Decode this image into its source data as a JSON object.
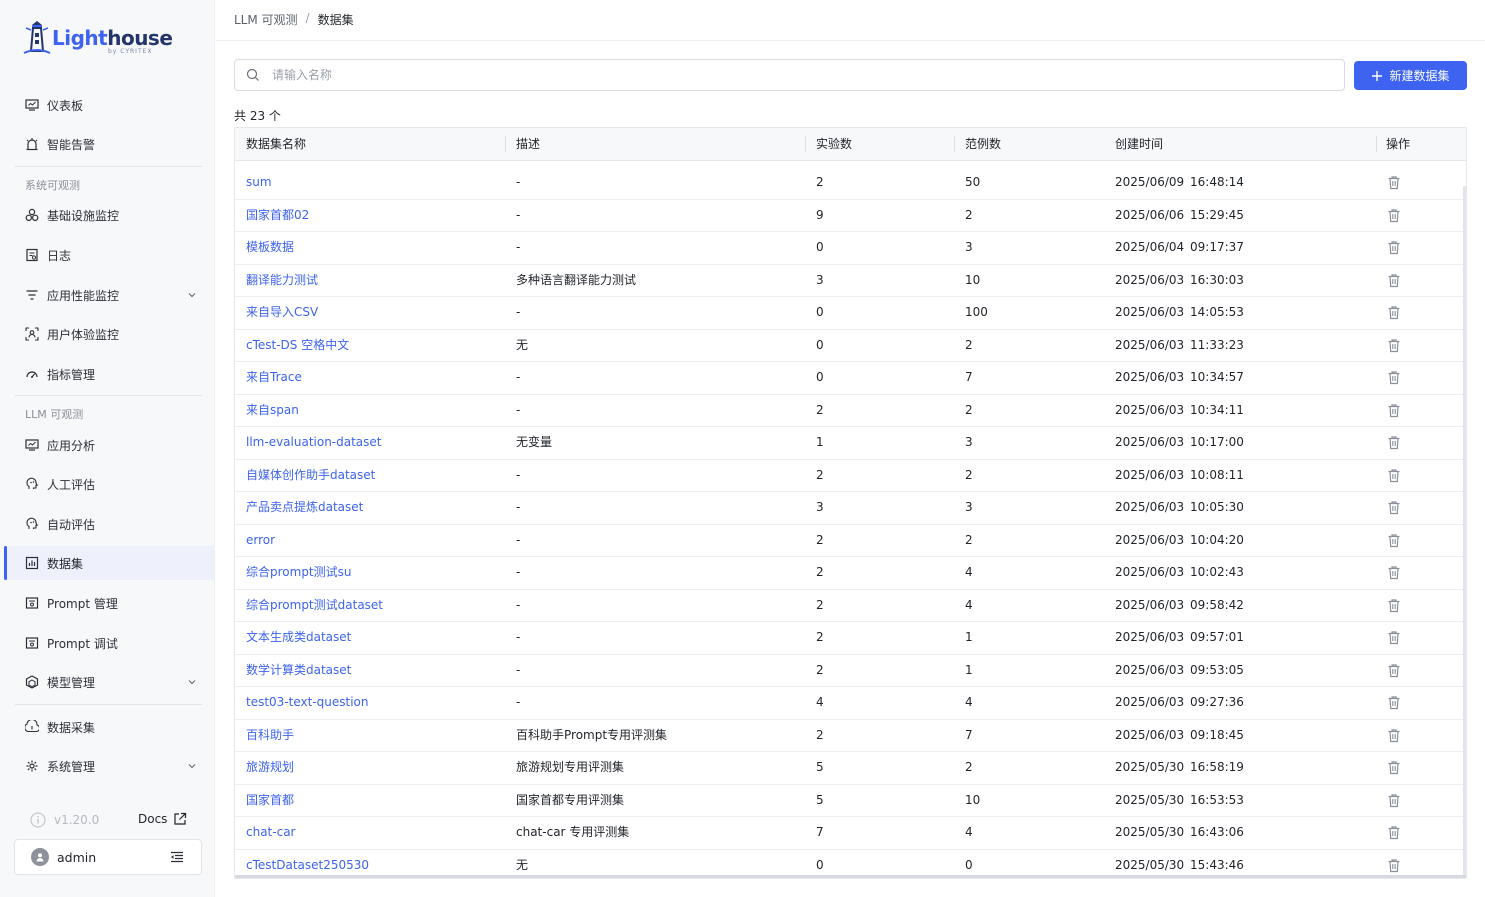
{
  "brand": {
    "name_a": "Light",
    "name_b": "house",
    "sub": "by CYRITEX"
  },
  "nav": {
    "dashboard": "仪表板",
    "alerts": "智能告警",
    "section_system": "系统可观测",
    "infra": "基础设施监控",
    "logs": "日志",
    "apm": "应用性能监控",
    "rum": "用户体验监控",
    "metrics": "指标管理",
    "section_llm": "LLM 可观测",
    "app_analysis": "应用分析",
    "human_eval": "人工评估",
    "auto_eval": "自动评估",
    "datasets": "数据集",
    "prompt_mgmt": "Prompt 管理",
    "prompt_debug": "Prompt 调试",
    "model_mgmt": "模型管理",
    "data_collect": "数据采集",
    "sys_mgmt": "系统管理"
  },
  "footer": {
    "version": "v1.20.0",
    "docs": "Docs",
    "user": "admin"
  },
  "breadcrumb": {
    "parent": "LLM 可观测",
    "sep": "/",
    "current": "数据集"
  },
  "search": {
    "placeholder": "请输入名称",
    "value": ""
  },
  "new_button": "新建数据集",
  "total": "共 23 个",
  "columns": {
    "name": "数据集名称",
    "desc": "描述",
    "experiments": "实验数",
    "examples": "范例数",
    "created": "创建时间",
    "actions": "操作"
  },
  "rows": [
    {
      "name": "sum",
      "desc": "-",
      "exp": "2",
      "ex": "50",
      "date": "2025/06/09",
      "time": "16:48:14"
    },
    {
      "name": "国家首都02",
      "desc": "-",
      "exp": "9",
      "ex": "2",
      "date": "2025/06/06",
      "time": "15:29:45"
    },
    {
      "name": "模板数据",
      "desc": "-",
      "exp": "0",
      "ex": "3",
      "date": "2025/06/04",
      "time": "09:17:37"
    },
    {
      "name": "翻译能力测试",
      "desc": "多种语言翻译能力测试",
      "exp": "3",
      "ex": "10",
      "date": "2025/06/03",
      "time": "16:30:03"
    },
    {
      "name": "来自导入CSV",
      "desc": "-",
      "exp": "0",
      "ex": "100",
      "date": "2025/06/03",
      "time": "14:05:53"
    },
    {
      "name": "cTest-DS 空格中文",
      "desc": "无",
      "exp": "0",
      "ex": "2",
      "date": "2025/06/03",
      "time": "11:33:23"
    },
    {
      "name": "来自Trace",
      "desc": "-",
      "exp": "0",
      "ex": "7",
      "date": "2025/06/03",
      "time": "10:34:57"
    },
    {
      "name": "来自span",
      "desc": "-",
      "exp": "2",
      "ex": "2",
      "date": "2025/06/03",
      "time": "10:34:11"
    },
    {
      "name": "llm-evaluation-dataset",
      "desc": "无变量",
      "exp": "1",
      "ex": "3",
      "date": "2025/06/03",
      "time": "10:17:00"
    },
    {
      "name": "自媒体创作助手dataset",
      "desc": "-",
      "exp": "2",
      "ex": "2",
      "date": "2025/06/03",
      "time": "10:08:11"
    },
    {
      "name": "产品卖点提炼dataset",
      "desc": "-",
      "exp": "3",
      "ex": "3",
      "date": "2025/06/03",
      "time": "10:05:30"
    },
    {
      "name": "error",
      "desc": "-",
      "exp": "2",
      "ex": "2",
      "date": "2025/06/03",
      "time": "10:04:20"
    },
    {
      "name": "综合prompt测试su",
      "desc": "-",
      "exp": "2",
      "ex": "4",
      "date": "2025/06/03",
      "time": "10:02:43"
    },
    {
      "name": "综合prompt测试dataset",
      "desc": "-",
      "exp": "2",
      "ex": "4",
      "date": "2025/06/03",
      "time": "09:58:42"
    },
    {
      "name": "文本生成类dataset",
      "desc": "-",
      "exp": "2",
      "ex": "1",
      "date": "2025/06/03",
      "time": "09:57:01"
    },
    {
      "name": "数学计算类dataset",
      "desc": "-",
      "exp": "2",
      "ex": "1",
      "date": "2025/06/03",
      "time": "09:53:05"
    },
    {
      "name": "test03-text-question",
      "desc": "-",
      "exp": "4",
      "ex": "4",
      "date": "2025/06/03",
      "time": "09:27:36"
    },
    {
      "name": "百科助手",
      "desc": "百科助手Prompt专用评测集",
      "exp": "2",
      "ex": "7",
      "date": "2025/06/03",
      "time": "09:18:45"
    },
    {
      "name": "旅游规划",
      "desc": "旅游规划专用评测集",
      "exp": "5",
      "ex": "2",
      "date": "2025/05/30",
      "time": "16:58:19"
    },
    {
      "name": "国家首都",
      "desc": "国家首都专用评测集",
      "exp": "5",
      "ex": "10",
      "date": "2025/05/30",
      "time": "16:53:53"
    },
    {
      "name": "chat-car",
      "desc": "chat-car 专用评测集",
      "exp": "7",
      "ex": "4",
      "date": "2025/05/30",
      "time": "16:43:06"
    },
    {
      "name": "cTestDataset250530",
      "desc": "无",
      "exp": "0",
      "ex": "0",
      "date": "2025/05/30",
      "time": "15:43:46"
    }
  ]
}
